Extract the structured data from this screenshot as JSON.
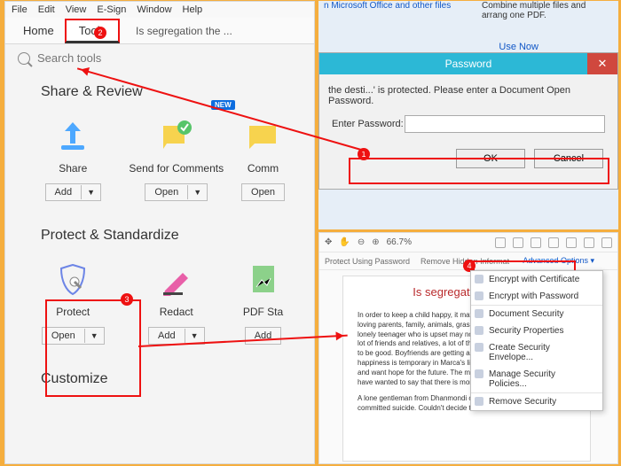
{
  "menubar": [
    "File",
    "Edit",
    "View",
    "E-Sign",
    "Window",
    "Help"
  ],
  "tabs": {
    "home": "Home",
    "tools": "Tools",
    "doc": "Is segregation the ..."
  },
  "search": {
    "placeholder": "Search tools"
  },
  "sections": {
    "share": "Share & Review",
    "protect": "Protect & Standardize",
    "customize": "Customize"
  },
  "tools": {
    "share": {
      "label": "Share",
      "btn": "Add"
    },
    "sendComments": {
      "label": "Send for Comments",
      "btn": "Open",
      "badge": "NEW"
    },
    "comment": {
      "label": "Comm",
      "btn": "Open"
    },
    "protect": {
      "label": "Protect",
      "btn": "Open"
    },
    "redact": {
      "label": "Redact",
      "btn": "Add"
    },
    "pdfStd": {
      "label": "PDF Sta",
      "btn": "Add"
    }
  },
  "caret": "▼",
  "office": {
    "left": "n Microsoft Office and other files",
    "right": "Combine multiple files and arrang one PDF.",
    "usenow": "Use Now"
  },
  "dialog": {
    "title": "Password",
    "close": "✕",
    "msg": "the desti...' is protected. Please enter a Document Open Password.",
    "label": "Enter Password:",
    "ok": "OK",
    "cancel": "Cancel"
  },
  "adv": {
    "zoom": "66.7%",
    "protectUsing": "Protect Using Password",
    "removeHidden": "Remove Hidden Informat",
    "advancedOptions": "Advanced Options",
    "menu": [
      "Encrypt with Certificate",
      "Encrypt with Password",
      "Document Security",
      "Security Properties",
      "Create Security Envelope...",
      "Manage Security Policies...",
      "Remove Security"
    ]
  },
  "doc": {
    "title": "Is segregation the de",
    "p1": "In order to keep a child happy, it matters a lot to surround them with loving parents, family, animals, grass, or anything interesting. The lonely teenager who is upset may not be able to say that he wants a lot of friends and relatives, a lot of thrills and a lot of love if he wants to be good. Boyfriends are getting along with girlfriends, but happiness is temporary in Marca's life. People want more people, and want hope for the future. The man who committed suicide may have wanted to say that there is more fear than death.",
    "p2": "A lone gentleman from Dhanmondi came on Facebook Live and committed suicide. Couldn't decide to watch the video. The"
  },
  "nums": {
    "n1": "1",
    "n2": "2",
    "n3": "3",
    "n4": "4"
  }
}
